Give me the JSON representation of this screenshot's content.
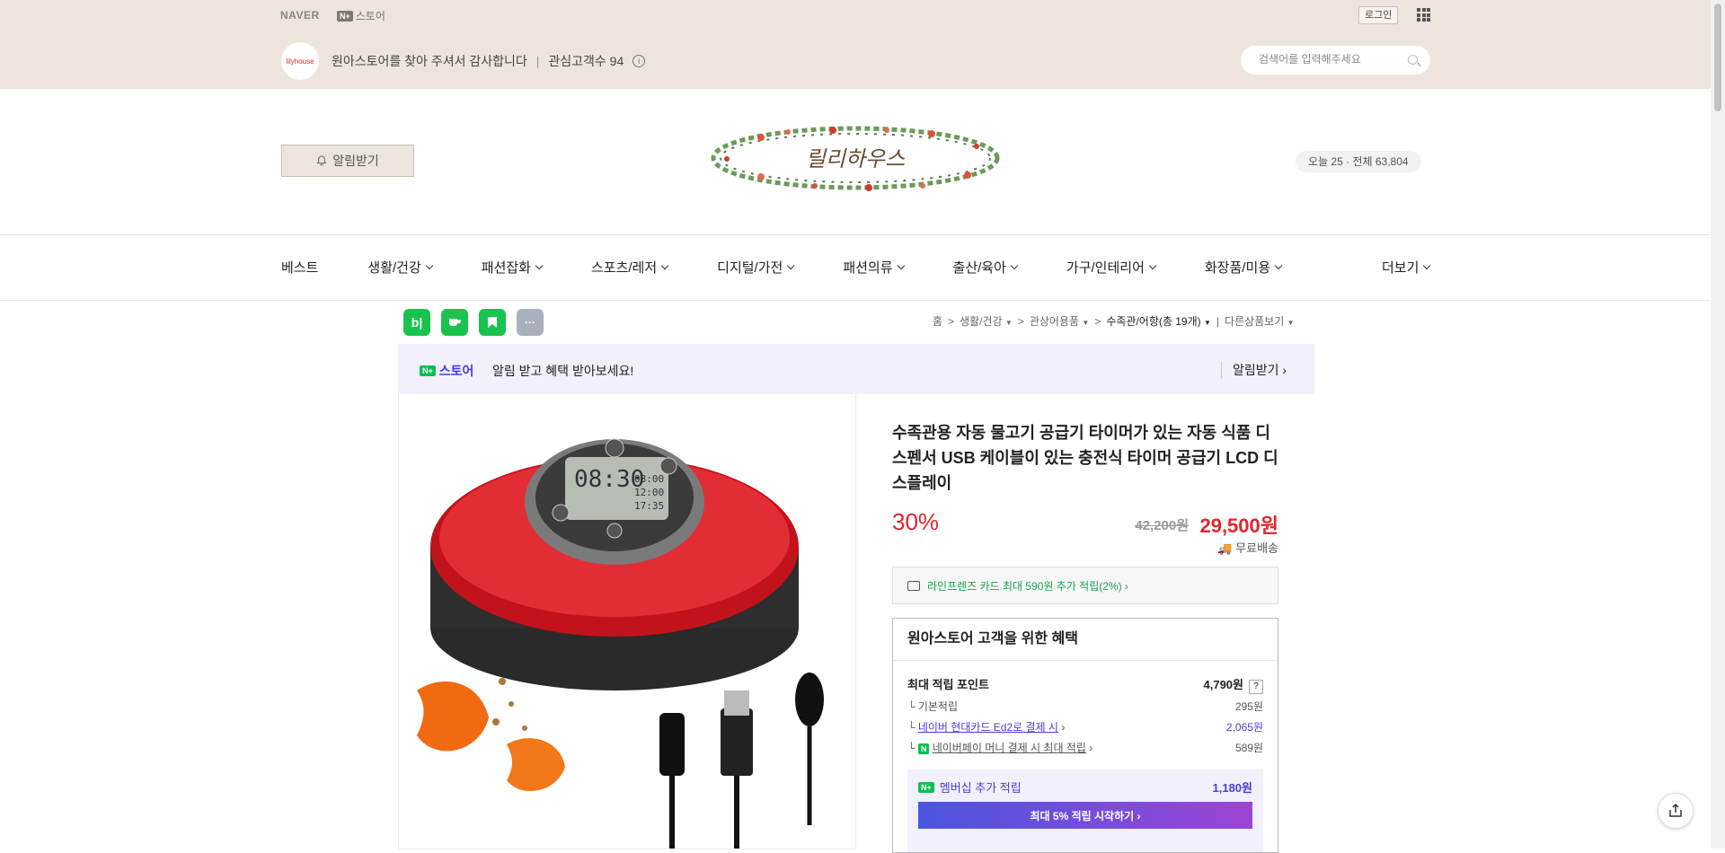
{
  "topbar": {
    "naver": "NAVER",
    "store_mark": "N+",
    "store": "스토어",
    "login": "로그인"
  },
  "header": {
    "avatar_text": "lilyhouse",
    "welcome": "원아스토어를 찾아 주셔서 감사합니다",
    "sep": "|",
    "followers": "관심고객수 94",
    "search_placeholder": "검색어를 입력해주세요",
    "alarm": "알림받기",
    "logo_text": "릴리하우스",
    "visitors": "오늘 25 · 전체 63,804"
  },
  "nav": {
    "items": [
      "베스트",
      "생활/건강",
      "패션잡화",
      "스포츠/레저",
      "디지털/가전",
      "패션의류",
      "출산/육아",
      "가구/인테리어",
      "화장품/미용"
    ],
    "more": "더보기"
  },
  "share": {
    "blog": "b|",
    "more": "···"
  },
  "breadcrumb": {
    "home": "홈",
    "c1": "생활/건강",
    "c2": "관상어용품",
    "c3": "수족관/어항(총 19개)",
    "other": "다른상품보기"
  },
  "promo": {
    "mark": "N+",
    "store": "스토어",
    "message": "알림 받고 혜택 받아보세요!",
    "action": "알림받기 ›"
  },
  "product": {
    "title": "수족관용 자동 물고기 공급기 타이머가 있는 자동 식품 디스펜서 USB 케이블이 있는 충전식 타이머 공급기 LCD 디스플레이",
    "discount": "30%",
    "original_price": "42,200원",
    "sale_price": "29,500원",
    "shipping": "무료배송",
    "card_benefit": "라인프렌즈 카드 최대 590원 추가 적립(2%) ›"
  },
  "benefits": {
    "title": "원아스토어 고객을 위한 혜택",
    "max_points_label": "최대 적립 포인트",
    "max_points": "4,790원",
    "q": "?",
    "basic_label": "기본적립",
    "basic": "295원",
    "card_label": "네이버 현대카드 Ed2로 결제 시",
    "card": "2,065원",
    "npay_label": "네이버페이 머니 결제 시 최대 적립",
    "npay": "589원",
    "member_mark": "N+",
    "member_label": "멤버십 추가 적립",
    "member_value": "1,180원",
    "member_btn": "최대 5% 적립 시작하기 ›"
  },
  "lcd": {
    "time": "08:30",
    "t2": "08:00",
    "t3": "12:00",
    "t4": "17:35"
  },
  "colors": {
    "band": "#ede5dc",
    "price_red": "#e1252f",
    "npay_green": "#0bbf4f",
    "purple": "#4a3cd8"
  }
}
